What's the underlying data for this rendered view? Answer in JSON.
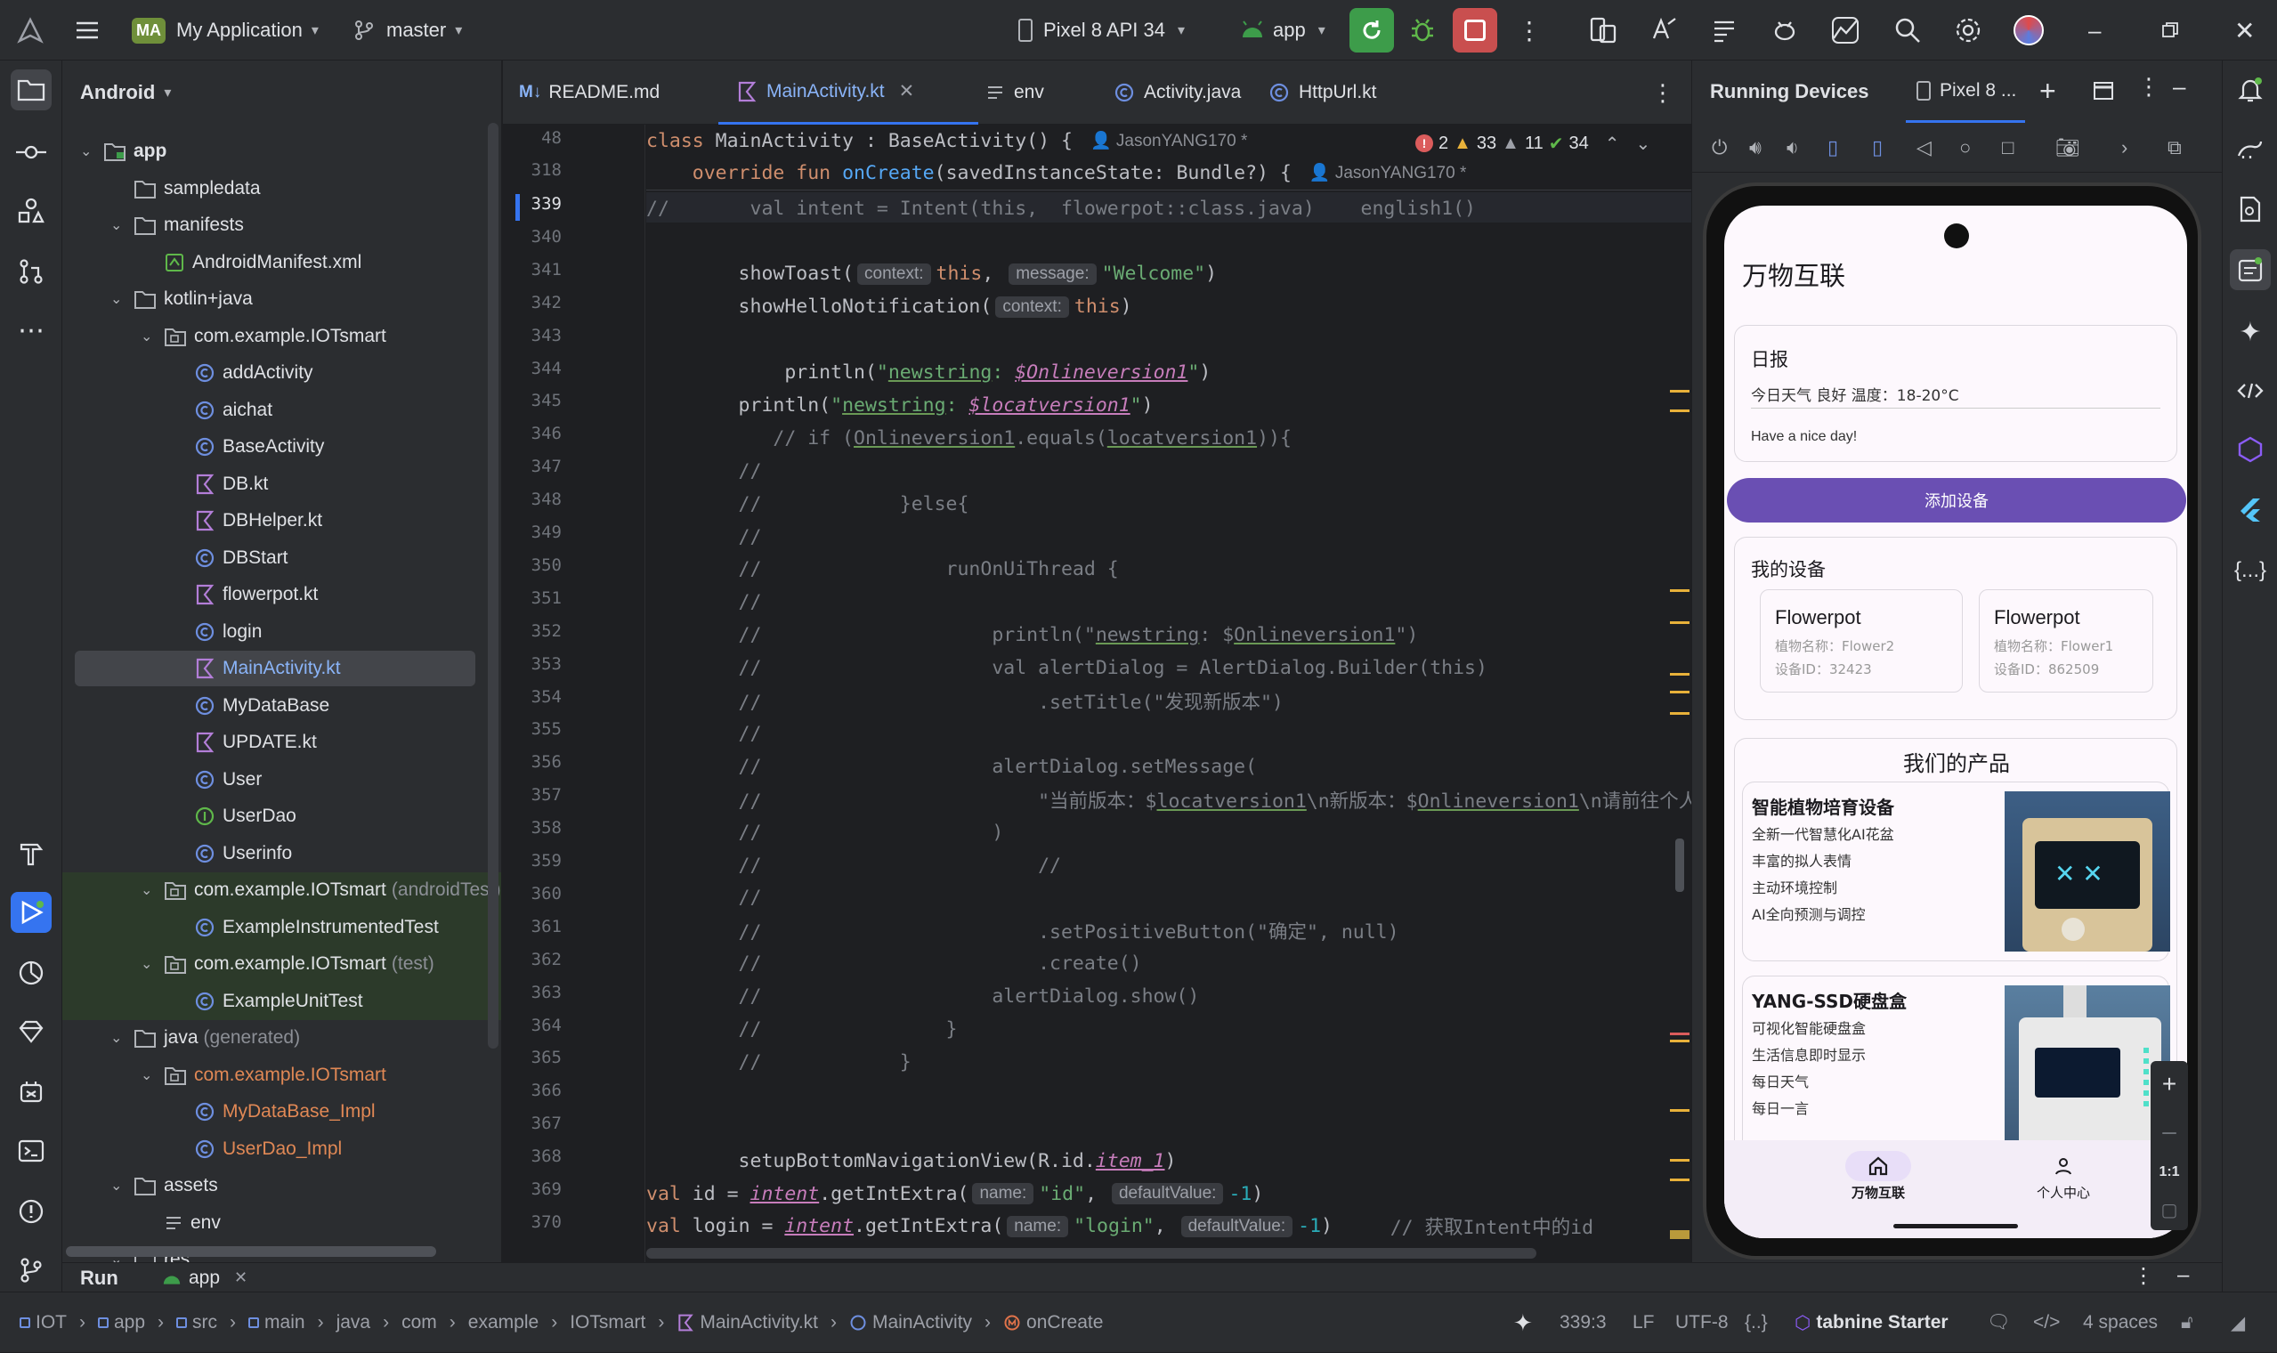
{
  "titlebar": {
    "project_badge": "MA",
    "project": "My Application",
    "branch": "master",
    "device": "Pixel 8 API 34",
    "run_config": "app"
  },
  "project_panel": {
    "view": "Android",
    "tree": [
      {
        "label": "app",
        "depth": 0,
        "kind": "module",
        "open": true
      },
      {
        "label": "sampledata",
        "depth": 1,
        "kind": "folder"
      },
      {
        "label": "manifests",
        "depth": 1,
        "kind": "folder",
        "open": true
      },
      {
        "label": "AndroidManifest.xml",
        "depth": 2,
        "kind": "xml"
      },
      {
        "label": "kotlin+java",
        "depth": 1,
        "kind": "folder",
        "open": true
      },
      {
        "label": "com.example.IOTsmart",
        "depth": 2,
        "kind": "package",
        "open": true
      },
      {
        "label": "addActivity",
        "depth": 3,
        "kind": "class"
      },
      {
        "label": "aichat",
        "depth": 3,
        "kind": "class"
      },
      {
        "label": "BaseActivity",
        "depth": 3,
        "kind": "class"
      },
      {
        "label": "DB.kt",
        "depth": 3,
        "kind": "kt"
      },
      {
        "label": "DBHelper.kt",
        "depth": 3,
        "kind": "kt"
      },
      {
        "label": "DBStart",
        "depth": 3,
        "kind": "class"
      },
      {
        "label": "flowerpot.kt",
        "depth": 3,
        "kind": "kt"
      },
      {
        "label": "login",
        "depth": 3,
        "kind": "class"
      },
      {
        "label": "MainActivity.kt",
        "depth": 3,
        "kind": "kt",
        "selected": true
      },
      {
        "label": "MyDataBase",
        "depth": 3,
        "kind": "class"
      },
      {
        "label": "UPDATE.kt",
        "depth": 3,
        "kind": "kt"
      },
      {
        "label": "User",
        "depth": 3,
        "kind": "class"
      },
      {
        "label": "UserDao",
        "depth": 3,
        "kind": "iface"
      },
      {
        "label": "Userinfo",
        "depth": 3,
        "kind": "class"
      },
      {
        "label": "com.example.IOTsmart",
        "suffix": "(androidTest)",
        "depth": 2,
        "kind": "package",
        "open": true,
        "test": true
      },
      {
        "label": "ExampleInstrumentedTest",
        "depth": 3,
        "kind": "class",
        "test": true
      },
      {
        "label": "com.example.IOTsmart",
        "suffix": "(test)",
        "depth": 2,
        "kind": "package",
        "open": true,
        "test": true
      },
      {
        "label": "ExampleUnitTest",
        "depth": 3,
        "kind": "class",
        "test": true
      },
      {
        "label": "java",
        "suffix": "(generated)",
        "depth": 1,
        "kind": "folder",
        "open": true
      },
      {
        "label": "com.example.IOTsmart",
        "depth": 2,
        "kind": "package",
        "open": true,
        "generated": true
      },
      {
        "label": "MyDataBase_Impl",
        "depth": 3,
        "kind": "class",
        "generated": true
      },
      {
        "label": "UserDao_Impl",
        "depth": 3,
        "kind": "class",
        "generated": true
      },
      {
        "label": "assets",
        "depth": 1,
        "kind": "folder",
        "open": true
      },
      {
        "label": "env",
        "depth": 2,
        "kind": "text"
      },
      {
        "label": "res",
        "depth": 1,
        "kind": "folder",
        "open": true
      }
    ]
  },
  "editor": {
    "tabs": [
      {
        "label": "README.md",
        "icon": "M↓"
      },
      {
        "label": "MainActivity.kt",
        "active": true
      },
      {
        "label": "env"
      },
      {
        "label": "Activity.java"
      },
      {
        "label": "HttpUrl.kt"
      }
    ],
    "sticky": [
      {
        "ln": "48",
        "code": "class MainActivity : BaseActivity() {",
        "author": "JasonYANG170 *"
      },
      {
        "ln": "318",
        "code": "    override fun onCreate(savedInstanceState: Bundle?) {",
        "author": "JasonYANG170 *"
      }
    ],
    "inspections": {
      "errors": "2",
      "warnings": "33",
      "weak": "11",
      "ok": "34"
    },
    "current_line_text": "//       val intent = Intent(this,  flowerpot::class.java)    english1()",
    "line_numbers": [
      "339",
      "340",
      "341",
      "342",
      "343",
      "344",
      "345",
      "346",
      "347",
      "348",
      "349",
      "350",
      "351",
      "352",
      "353",
      "354",
      "355",
      "356",
      "357",
      "358",
      "359",
      "360",
      "361",
      "362",
      "363",
      "364",
      "365",
      "366",
      "367",
      "368",
      "369",
      "370"
    ]
  },
  "device_panel": {
    "title": "Running Devices",
    "tab": "Pixel 8 ...",
    "zoom_label": "1:1"
  },
  "app": {
    "title": "万物互联",
    "daily": {
      "heading": "日报",
      "weather": "今日天气 良好 温度：18-20°C",
      "message": "Have a nice day!"
    },
    "add_button": "添加设备",
    "devices": {
      "heading": "我的设备",
      "items": [
        {
          "name": "Flowerpot",
          "plant": "植物名称：Flower2",
          "id": "设备ID：32423"
        },
        {
          "name": "Flowerpot",
          "plant": "植物名称：Flower1",
          "id": "设备ID：862509"
        }
      ]
    },
    "products": {
      "heading": "我们的产品",
      "items": [
        {
          "name": "智能植物培育设备",
          "lines": [
            "全新一代智慧化AI花盆",
            "丰富的拟人表情",
            "主动环境控制",
            "AI全向预测与调控"
          ]
        },
        {
          "name": "YANG-SSD硬盘盒",
          "lines": [
            "可视化智能硬盘盒",
            "生活信息即时显示",
            "每日天气",
            "每日一言"
          ]
        }
      ]
    },
    "nav": [
      {
        "label": "万物互联",
        "active": true
      },
      {
        "label": "个人中心"
      }
    ]
  },
  "runbar": {
    "label": "Run",
    "config": "app"
  },
  "statusbar": {
    "crumbs": [
      "IOT",
      "app",
      "src",
      "main",
      "java",
      "com",
      "example",
      "IOTsmart",
      "MainActivity.kt",
      "MainActivity",
      "onCreate"
    ],
    "position": "339:3",
    "line_sep": "LF",
    "encoding": "UTF-8",
    "indent": "4 spaces",
    "tabnine": "tabnine",
    "tabnine_plan": "Starter"
  },
  "colors": {
    "accent": "#6a4fb3",
    "bg": "#1e1f22",
    "panel": "#2b2d30",
    "run_green": "#3d9c4a",
    "stop_red": "#c94f4f"
  }
}
